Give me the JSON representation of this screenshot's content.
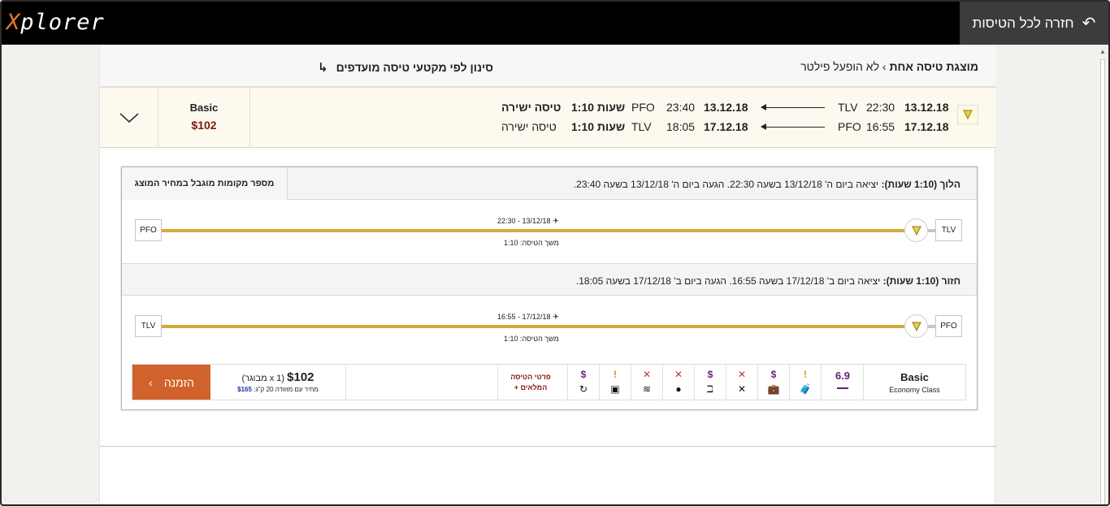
{
  "app": {
    "logo_x": "X",
    "logo_rest": "plorer",
    "back_label": "חזרה לכל הטיסות",
    "back_arrow": "↶"
  },
  "filter": {
    "showing_bold": "מוצגת טיסה אחת",
    "showing_sep": "›",
    "showing_rest": "לא הופעל פילטר",
    "segment_filter_label": "סינון לפי מקטעי טיסה מועדפים",
    "segment_filter_arrow": "↳"
  },
  "summary": {
    "fare_name": "Basic",
    "price": "$102",
    "outbound": {
      "date": "13.12.18",
      "dep_time": "22:30",
      "dep_airport": "TLV",
      "arr_date": "13.12.18",
      "arr_time": "23:40",
      "arr_airport": "PFO",
      "duration": "1:10 שעות",
      "type": "טיסה ישירה"
    },
    "inbound": {
      "date": "17.12.18",
      "dep_time": "16:55",
      "dep_airport": "PFO",
      "arr_date": "17.12.18",
      "arr_time": "18:05",
      "arr_airport": "TLV",
      "duration": "1:10 שעות",
      "type": "טיסה ישירה"
    }
  },
  "details": {
    "seats_note": "מספר מקומות מוגבל במחיר המוצג",
    "outbound_head_bold": "הלוך (1:10 שעות):",
    "outbound_head_text": "יציאה ביום ה' 13/12/18 בשעה 22:30. הגעה ביום ה' 13/12/18 בשעה 23:40.",
    "outbound_from": "TLV",
    "outbound_to": "PFO",
    "outbound_time": "13/12/18 - 22:30",
    "outbound_duration": "משך הטיסה: 1:10",
    "inbound_head_bold": "חזור (1:10 שעות):",
    "inbound_head_text": "יציאה ביום ב' 17/12/18 בשעה 16:55. הגעה ביום ב' 17/12/18 בשעה 18:05.",
    "inbound_from": "PFO",
    "inbound_to": "TLV",
    "inbound_time": "17/12/18 - 16:55",
    "inbound_duration": "משך הטיסה: 1:10"
  },
  "fare": {
    "name": "Basic",
    "class": "Economy Class",
    "score": "6.9",
    "details_link_line1": "פרטי הטיסה",
    "details_link_line2": "המלאים +",
    "price": "$102",
    "per_adult": "(1 x מבוגר)",
    "luggage_note": "מחיר עם מזוודה 20 ק\"ג:",
    "luggage_price": "$165",
    "book_label": "הזמנה",
    "book_arrow": "›",
    "amenities": [
      {
        "status": "!",
        "status_color": "#e08a13",
        "icon": "personal-item",
        "glyph": "🧳"
      },
      {
        "status": "$",
        "status_color": "#6a1b7d",
        "icon": "cabin-bag",
        "glyph": "💼"
      },
      {
        "status": "✕",
        "status_color": "#c0322b",
        "icon": "meal",
        "glyph": "✕"
      },
      {
        "status": "$",
        "status_color": "#6a1b7d",
        "icon": "seat",
        "glyph": "ℶ"
      },
      {
        "status": "✕",
        "status_color": "#c0322b",
        "icon": "entertainment",
        "glyph": "●"
      },
      {
        "status": "✕",
        "status_color": "#c0322b",
        "icon": "wifi",
        "glyph": "≋"
      },
      {
        "status": "!",
        "status_color": "#e08a13",
        "icon": "power",
        "glyph": "▣"
      },
      {
        "status": "$",
        "status_color": "#6a1b7d",
        "icon": "change",
        "glyph": "↻"
      }
    ]
  }
}
